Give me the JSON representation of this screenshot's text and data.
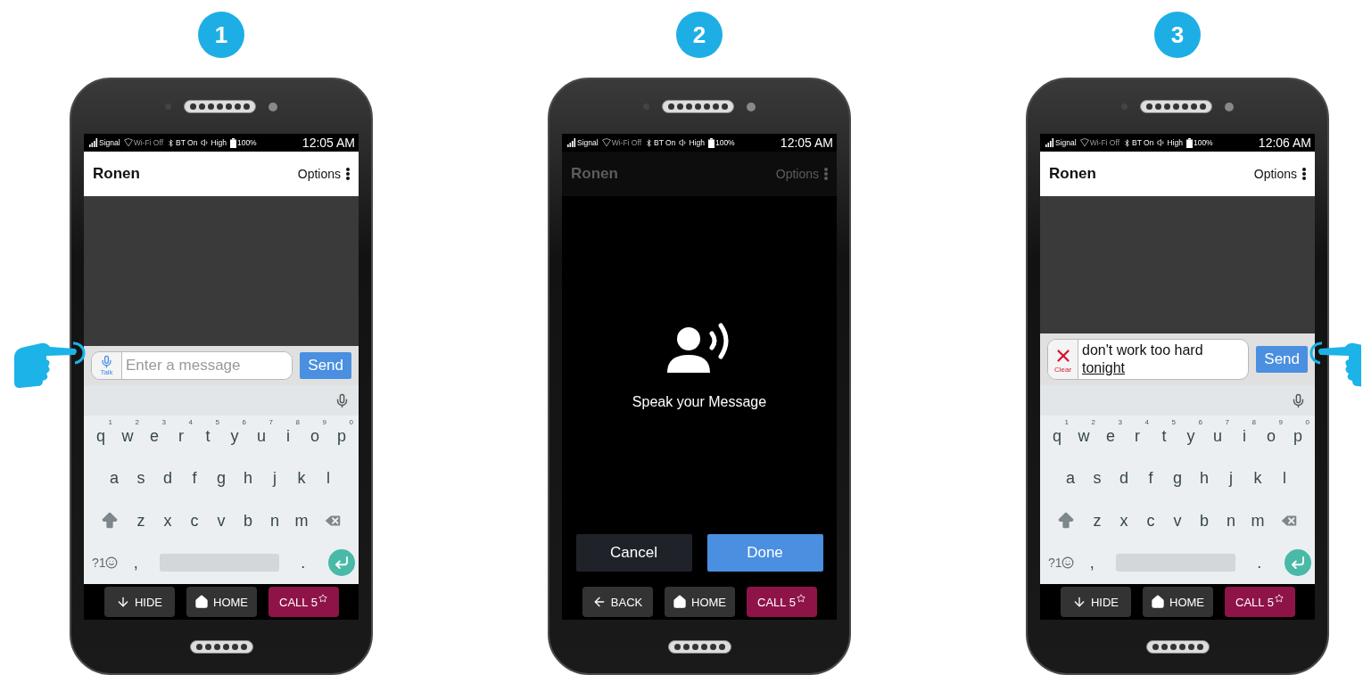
{
  "steps": [
    {
      "number": "1",
      "kind": "chat",
      "status": {
        "items": [
          {
            "kind": "signal",
            "label": "Signal",
            "active": true
          },
          {
            "kind": "wifi",
            "label": "Wi-Fi Off",
            "active": false
          },
          {
            "kind": "bluetooth",
            "label": "BT On",
            "active": true
          },
          {
            "kind": "volume",
            "label": "High",
            "active": true
          },
          {
            "kind": "battery",
            "label": "100%",
            "active": true
          }
        ],
        "time": "12:05 AM"
      },
      "header": {
        "title": "Ronen",
        "options": "Options",
        "dimmed": false
      },
      "composer": {
        "kind": "talk",
        "pointed": true,
        "action_label": "Talk",
        "placeholder": "Enter a message",
        "send": "Send"
      },
      "keyboard": {
        "rows": [
          [
            {
              "key": "q",
              "hint": "1"
            },
            {
              "key": "w",
              "hint": "2"
            },
            {
              "key": "e",
              "hint": "3"
            },
            {
              "key": "r",
              "hint": "4"
            },
            {
              "key": "t",
              "hint": "5"
            },
            {
              "key": "y",
              "hint": "6"
            },
            {
              "key": "u",
              "hint": "7"
            },
            {
              "key": "i",
              "hint": "8"
            },
            {
              "key": "o",
              "hint": "9"
            },
            {
              "key": "p",
              "hint": "0"
            }
          ],
          [
            {
              "key": "a"
            },
            {
              "key": "s"
            },
            {
              "key": "d"
            },
            {
              "key": "f"
            },
            {
              "key": "g"
            },
            {
              "key": "h"
            },
            {
              "key": "j"
            },
            {
              "key": "k"
            },
            {
              "key": "l"
            }
          ],
          [
            {
              "key": "z"
            },
            {
              "key": "x"
            },
            {
              "key": "c"
            },
            {
              "key": "v"
            },
            {
              "key": "b"
            },
            {
              "key": "n"
            },
            {
              "key": "m"
            }
          ]
        ],
        "symbols": "?1",
        "comma": ",",
        "period": "."
      },
      "nav": [
        {
          "kind": "hide",
          "label": "HIDE"
        },
        {
          "kind": "home",
          "label": "HOME"
        },
        {
          "kind": "call",
          "label": "CALL 5"
        }
      ]
    },
    {
      "number": "2",
      "kind": "voice",
      "status": {
        "items": [
          {
            "kind": "signal",
            "label": "Signal",
            "active": true
          },
          {
            "kind": "wifi",
            "label": "Wi-Fi Off",
            "active": false
          },
          {
            "kind": "bluetooth",
            "label": "BT On",
            "active": true
          },
          {
            "kind": "volume",
            "label": "High",
            "active": true
          },
          {
            "kind": "battery",
            "label": "100%",
            "active": true
          }
        ],
        "time": "12:05 AM"
      },
      "header": {
        "title": "Ronen",
        "options": "Options",
        "dimmed": true
      },
      "prompt": "Speak your Message",
      "buttons": [
        {
          "label": "Cancel",
          "primary": false
        },
        {
          "label": "Done",
          "primary": true
        }
      ],
      "nav": [
        {
          "kind": "back",
          "label": "BACK"
        },
        {
          "kind": "home",
          "label": "HOME"
        },
        {
          "kind": "call",
          "label": "CALL 5"
        }
      ]
    },
    {
      "number": "3",
      "kind": "chat",
      "status": {
        "items": [
          {
            "kind": "signal",
            "label": "Signal",
            "active": true
          },
          {
            "kind": "wifi",
            "label": "Wi-Fi Off",
            "active": false
          },
          {
            "kind": "bluetooth",
            "label": "BT On",
            "active": true
          },
          {
            "kind": "volume",
            "label": "High",
            "active": true
          },
          {
            "kind": "battery",
            "label": "100%",
            "active": true
          }
        ],
        "time": "12:06 AM"
      },
      "header": {
        "title": "Ronen",
        "options": "Options",
        "dimmed": false
      },
      "composer": {
        "kind": "clear",
        "pointed": true,
        "action_label": "Clear",
        "value": "don't work too hard",
        "composing": "tonight",
        "send": "Send"
      },
      "keyboard": {
        "rows": [
          [
            {
              "key": "q",
              "hint": "1"
            },
            {
              "key": "w",
              "hint": "2"
            },
            {
              "key": "e",
              "hint": "3"
            },
            {
              "key": "r",
              "hint": "4"
            },
            {
              "key": "t",
              "hint": "5"
            },
            {
              "key": "y",
              "hint": "6"
            },
            {
              "key": "u",
              "hint": "7"
            },
            {
              "key": "i",
              "hint": "8"
            },
            {
              "key": "o",
              "hint": "9"
            },
            {
              "key": "p",
              "hint": "0"
            }
          ],
          [
            {
              "key": "a"
            },
            {
              "key": "s"
            },
            {
              "key": "d"
            },
            {
              "key": "f"
            },
            {
              "key": "g"
            },
            {
              "key": "h"
            },
            {
              "key": "j"
            },
            {
              "key": "k"
            },
            {
              "key": "l"
            }
          ],
          [
            {
              "key": "z"
            },
            {
              "key": "x"
            },
            {
              "key": "c"
            },
            {
              "key": "v"
            },
            {
              "key": "b"
            },
            {
              "key": "n"
            },
            {
              "key": "m"
            }
          ]
        ],
        "symbols": "?1",
        "comma": ",",
        "period": "."
      },
      "nav": [
        {
          "kind": "hide",
          "label": "HIDE"
        },
        {
          "kind": "home",
          "label": "HOME"
        },
        {
          "kind": "call",
          "label": "CALL 5"
        }
      ]
    }
  ]
}
